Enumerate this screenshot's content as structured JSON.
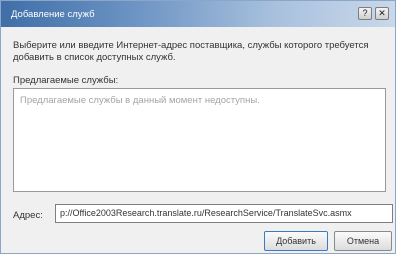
{
  "window": {
    "title": "Добавление служб",
    "controls": {
      "help": "?",
      "close": "✕"
    }
  },
  "instructions": "Выберите или введите Интернет-адрес поставщика, службы которого требуется добавить в список доступных служб.",
  "list": {
    "label": "Предлагаемые службы:",
    "empty_text": "Предлагаемые службы в данный момент недоступны."
  },
  "address": {
    "label": "Адрес:",
    "value": "p://Office2003Research.translate.ru/ResearchService/TranslateSvc.asmx"
  },
  "buttons": {
    "add": "Добавить",
    "cancel": "Отмена"
  }
}
